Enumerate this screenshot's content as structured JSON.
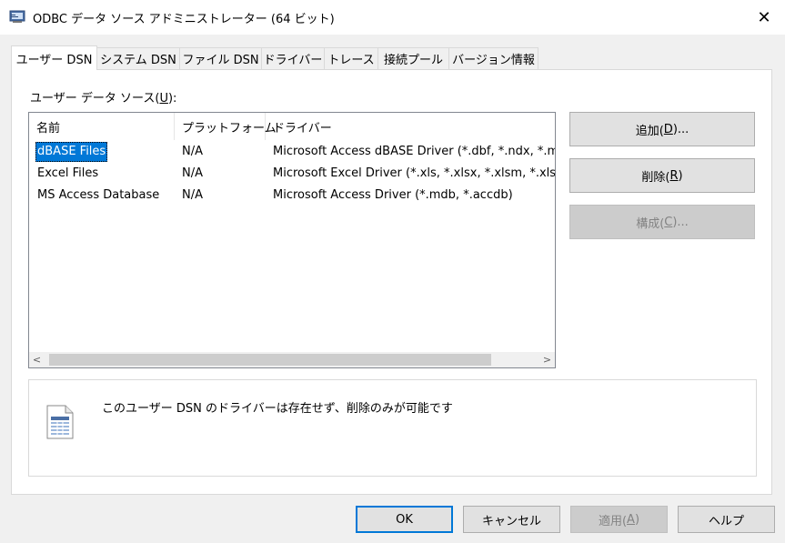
{
  "window": {
    "title": "ODBC データ ソース アドミニストレーター (64 ビット)",
    "close_glyph": "✕"
  },
  "tabs": [
    {
      "label": "ユーザー DSN",
      "active": true
    },
    {
      "label": "システム DSN",
      "active": false
    },
    {
      "label": "ファイル DSN",
      "active": false
    },
    {
      "label": "ドライバー",
      "active": false
    },
    {
      "label": "トレース",
      "active": false
    },
    {
      "label": "接続プール",
      "active": false
    },
    {
      "label": "バージョン情報",
      "active": false
    }
  ],
  "user_dsn": {
    "section_label_pre": "ユーザー データ ソース(",
    "section_label_key": "U",
    "section_label_post": "):",
    "columns": [
      "名前",
      "プラットフォーム",
      "ドライバー"
    ],
    "rows": [
      {
        "name": "dBASE Files",
        "platform": "N/A",
        "driver": "Microsoft Access dBASE Driver (*.dbf, *.ndx, *.mdx)",
        "selected": true
      },
      {
        "name": "Excel Files",
        "platform": "N/A",
        "driver": "Microsoft Excel Driver (*.xls, *.xlsx, *.xlsm, *.xlsb)",
        "selected": false
      },
      {
        "name": "MS Access Database",
        "platform": "N/A",
        "driver": "Microsoft Access Driver (*.mdb, *.accdb)",
        "selected": false
      }
    ],
    "scroll_left": "<",
    "scroll_right": ">"
  },
  "side_buttons": {
    "add": {
      "pre": "追加(",
      "key": "D",
      "post": ")..."
    },
    "remove": {
      "pre": "削除(",
      "key": "R",
      "post": ")"
    },
    "configure": {
      "pre": "構成(",
      "key": "C",
      "post": ")..."
    }
  },
  "info": {
    "text": "このユーザー DSN のドライバーは存在せず、削除のみが可能です"
  },
  "footer": {
    "ok": "OK",
    "cancel": "キャンセル",
    "apply_pre": "適用(",
    "apply_key": "A",
    "apply_post": ")",
    "help": "ヘルプ"
  },
  "colors": {
    "selection": "#0078d7",
    "panel": "#ffffff",
    "window": "#f0f0f0"
  }
}
